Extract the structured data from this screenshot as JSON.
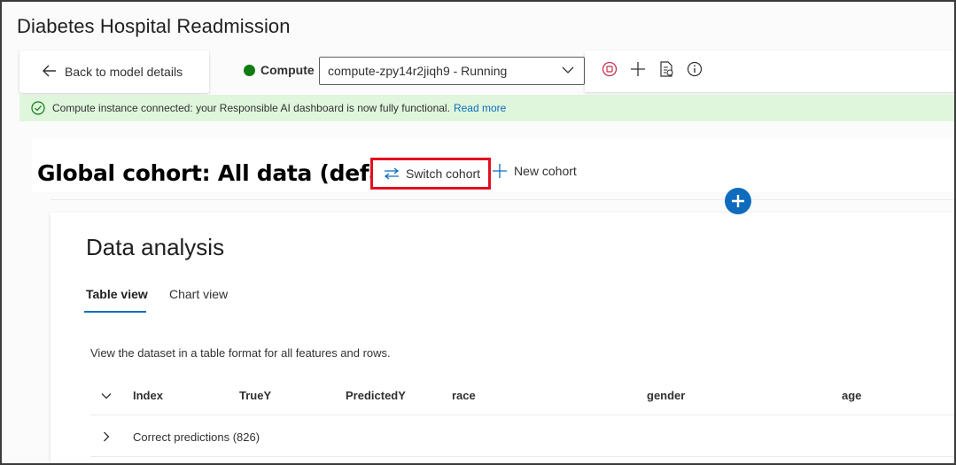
{
  "page": {
    "title": "Diabetes Hospital Readmission"
  },
  "nav": {
    "back_label": "Back to model details"
  },
  "compute": {
    "label": "Compute",
    "status_color": "#107c10",
    "selected": "compute-zpy14r2jiqh9 - Running"
  },
  "toolbar": {
    "icons": [
      "stop-icon",
      "add-icon",
      "report-icon",
      "info-icon"
    ]
  },
  "banner": {
    "message": "Compute instance connected: your Responsible AI dashboard is now fully functional.",
    "link": "Read more",
    "background": "#dff6dd"
  },
  "cohort": {
    "title": "Global cohort: All data (default)",
    "switch_label": "Switch cohort",
    "new_label": "New cohort",
    "highlight_color": "#e3101f"
  },
  "analysis": {
    "title": "Data analysis",
    "tabs": [
      {
        "label": "Table view",
        "active": true
      },
      {
        "label": "Chart view",
        "active": false
      }
    ],
    "description": "View the dataset in a table format for all features and rows.",
    "columns": [
      "Index",
      "TrueY",
      "PredictedY",
      "race",
      "gender",
      "age"
    ],
    "groups": [
      {
        "label": "Correct predictions (826)"
      }
    ]
  },
  "accent": "#0f6cbd"
}
